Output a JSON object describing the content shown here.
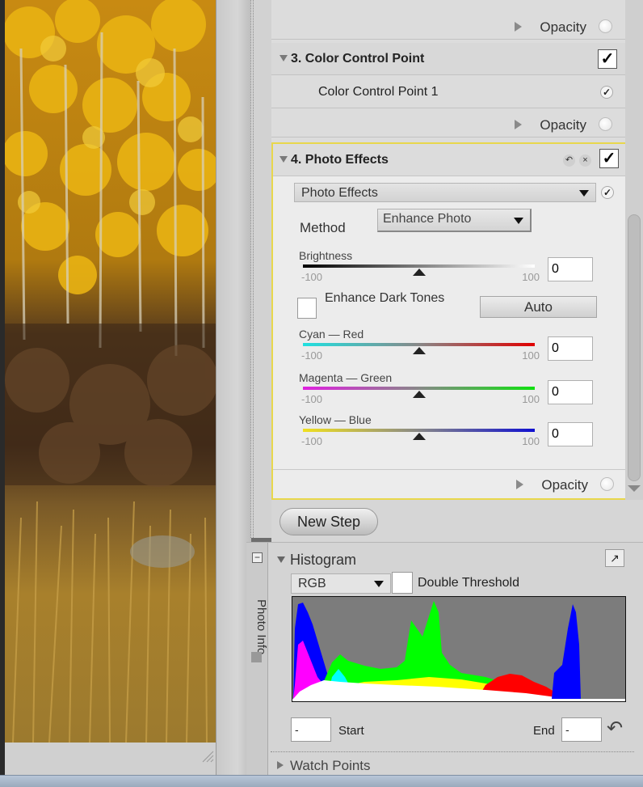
{
  "layers": {
    "top_opacity": "Opacity",
    "color_control": {
      "title": "3. Color Control Point",
      "check": "✓",
      "point_name": "Color Control Point 1",
      "point_check": "✓",
      "opacity": "Opacity"
    },
    "photo_effects": {
      "title": "4. Photo Effects",
      "undo_icon": "↶",
      "reset_icon": "×",
      "check": "✓",
      "effect_dropdown": "Photo Effects",
      "effect_check": "✓",
      "method_label": "Method",
      "method_value": "Enhance Photo",
      "brightness": {
        "label": "Brightness",
        "min": "-100",
        "max": "100",
        "value": "0"
      },
      "enhance_dark_tones": "Enhance Dark Tones",
      "auto_label": "Auto",
      "cyan_red": {
        "label": "Cyan — Red",
        "min": "-100",
        "max": "100",
        "value": "0"
      },
      "magenta_green": {
        "label": "Magenta — Green",
        "min": "-100",
        "max": "100",
        "value": "0"
      },
      "yellow_blue": {
        "label": "Yellow — Blue",
        "min": "-100",
        "max": "100",
        "value": "0"
      },
      "opacity": "Opacity"
    }
  },
  "new_step_label": "New Step",
  "photo_info": {
    "tab_label": "Photo Info",
    "histogram_title": "Histogram",
    "channel": "RGB",
    "double_threshold": "Double Threshold",
    "start_value": "-",
    "start_label": "Start",
    "end_label": "End",
    "end_value": "-",
    "watch_points": "Watch Points"
  },
  "colors": {
    "selected_border": "#e8d74c",
    "histo_blue": "#0000ff",
    "histo_magenta": "#ff00ff",
    "histo_green": "#00ff00",
    "histo_yellow": "#ffff00",
    "histo_red": "#ff0000",
    "histo_cyan": "#00ffff"
  }
}
